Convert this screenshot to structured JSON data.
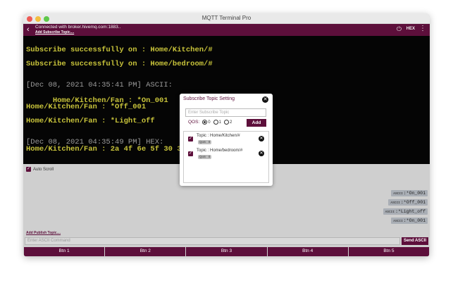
{
  "window": {
    "title": "MQTT Terminal Pro"
  },
  "appbar": {
    "connection_text": "Connected with broker.hivemq.com:1883..",
    "add_subscribe_topic": "Add Subscribe Topic....",
    "hex_label": "HEX"
  },
  "terminal": {
    "lines": [
      "Subscribe successfully on : Home/Kitchen/#",
      "Subscribe successfully on : Home/bedroom/#",
      "[Dec 08, 2021 04:35:41 PM] ASCII:",
      "Home/Kitchen/Fan : *On_001",
      "Home/Kitchen/Fan : *Off_001",
      "Home/Kitchen/Fan : *Light_off",
      "[Dec 08, 2021 04:35:49 PM] HEX:",
      "Home/Kitchen/Fan : 2a 4f 6e 5f 30 30"
    ]
  },
  "lower": {
    "auto_scroll": "Auto Scroll",
    "auto_scroll_checked": true,
    "sent_chips": [
      {
        "prefix": "ASCII",
        "text": ":*On_001"
      },
      {
        "prefix": "ASCII",
        "text": ":*Off_001"
      },
      {
        "prefix": "ASCII",
        "text": ":*Light_off"
      },
      {
        "prefix": "ASCII",
        "text": ":*On_001"
      }
    ],
    "add_publish_topic": "Add Publish Topic....",
    "command_placeholder": "Enter ASCII Command",
    "send_label": "Send ASCII"
  },
  "buttons": [
    "Btn 1",
    "Btn 2",
    "Btn 3",
    "Btn 4",
    "Btn 5"
  ],
  "dialog": {
    "title": "Subscribe Topic Setting",
    "input_placeholder": "Enter Subscribe Topic",
    "qos_label": "QOS:",
    "qos_options": [
      "0",
      "1",
      "2"
    ],
    "qos_selected": "0",
    "add_label": "Add",
    "topics": [
      {
        "name": "Topic : Home/Kitchen/#",
        "qos": "QoS : 0",
        "checked": true
      },
      {
        "name": "Topic : Home/bedroom/#",
        "qos": "QoS : 0",
        "checked": true
      }
    ]
  },
  "colors": {
    "brand": "#5d0f3b",
    "terminal_bg": "#050505",
    "terminal_yellow": "#c8c33a"
  }
}
